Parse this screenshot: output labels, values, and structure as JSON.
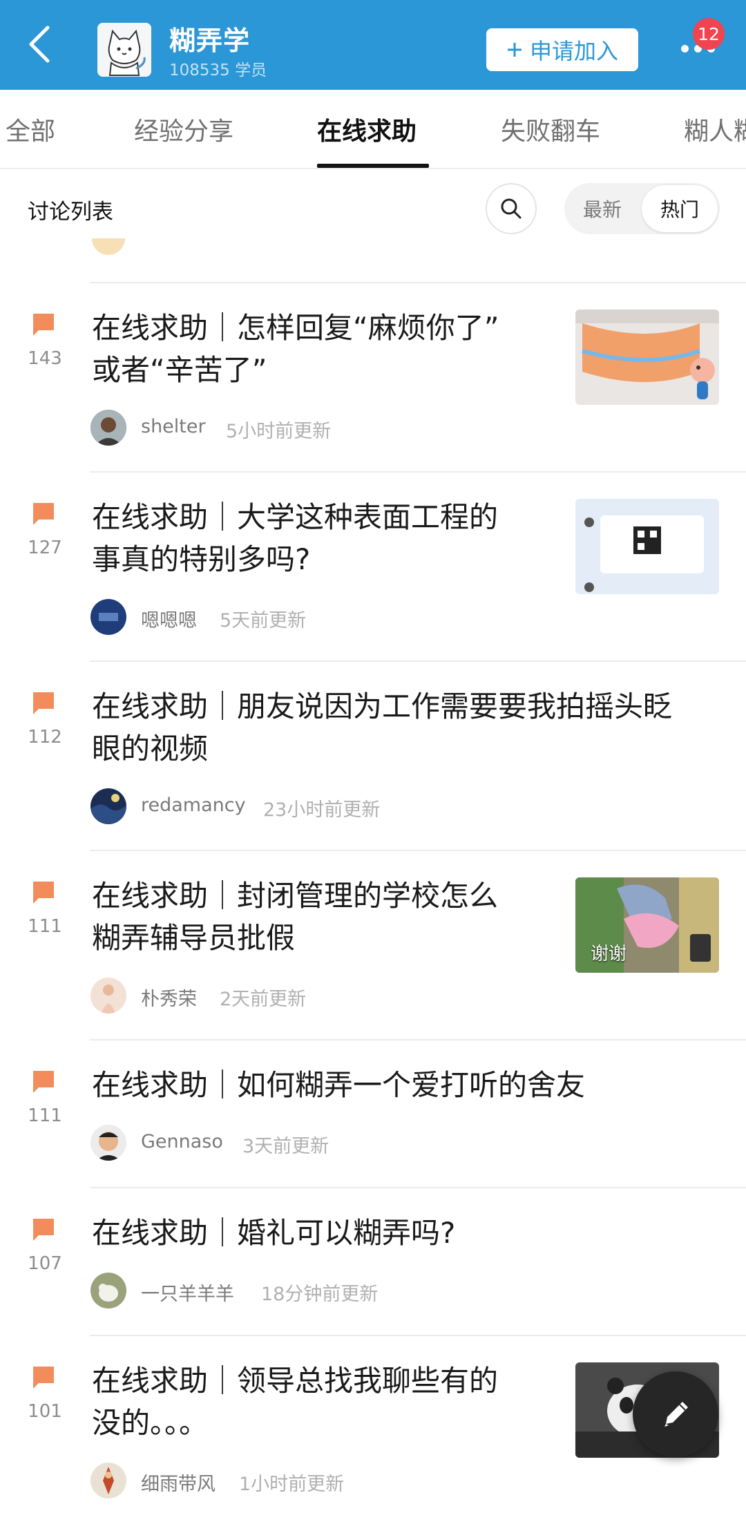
{
  "header": {
    "group_name": "糊弄学",
    "member_count": "108535 学员",
    "join_label": "申请加入",
    "notification_count": "12",
    "accent": "#2b97d6"
  },
  "tabs": [
    {
      "label": "全部",
      "active": false
    },
    {
      "label": "经验分享",
      "active": false
    },
    {
      "label": "在线求助",
      "active": true
    },
    {
      "label": "失败翻车",
      "active": false
    },
    {
      "label": "糊人糊",
      "active": false
    }
  ],
  "list": {
    "title": "讨论列表",
    "sort_options": [
      "最新",
      "热门"
    ],
    "sort_selected": "热门"
  },
  "posts": [
    {
      "count": "143",
      "title_line1": "在线求助｜怎样回复“麻烦你了”",
      "title_line2": "或者“辛苦了”",
      "author": "shelter",
      "time": "5小时前更新"
    },
    {
      "count": "127",
      "title_line1": "在线求助｜大学这种表面工程的",
      "title_line2": "事真的特别多吗?",
      "author": "嗯嗯嗯",
      "time": "5天前更新"
    },
    {
      "count": "112",
      "title_line1": "在线求助｜朋友说因为工作需要要我拍摇头眨",
      "title_line2": "眼的视频",
      "author": "redamancy",
      "time": "23小时前更新"
    },
    {
      "count": "111",
      "title_line1": "在线求助｜封闭管理的学校怎么",
      "title_line2": "糊弄辅导员批假",
      "author": "朴秀荣",
      "time": "2天前更新",
      "thumb_text": "谢谢"
    },
    {
      "count": "111",
      "title_line1": "在线求助｜如何糊弄一个爱打听的舍友",
      "title_line2": "",
      "author": "Gennaso",
      "time": "3天前更新"
    },
    {
      "count": "107",
      "title_line1": "在线求助｜婚礼可以糊弄吗?",
      "title_line2": "",
      "author": "一只羊羊羊",
      "time": "18分钟前更新"
    },
    {
      "count": "101",
      "title_line1": "在线求助｜领导总找我聊些有的",
      "title_line2": "没的。。。",
      "author": "细雨带风",
      "time": "1小时前更新"
    }
  ],
  "icons": {
    "back": "back-arrow-icon",
    "more": "more-dots-icon",
    "search": "search-icon",
    "comment": "comment-flag-icon",
    "compose": "pencil-icon"
  }
}
